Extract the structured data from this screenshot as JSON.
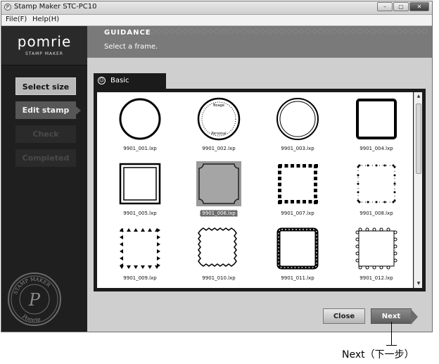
{
  "window": {
    "title": "Stamp Maker STC-PC10",
    "app_icon_glyph": "P",
    "controls": [
      "–",
      "▢",
      "✕"
    ]
  },
  "menu": [
    "File(F)",
    "Help(H)"
  ],
  "brand": {
    "logo": "pomrie",
    "tagline": "STAMP MAKER"
  },
  "steps": [
    {
      "label": "Select size",
      "state": "done"
    },
    {
      "label": "Edit stamp",
      "state": "current"
    },
    {
      "label": "Check",
      "state": "disabled"
    },
    {
      "label": "Completed",
      "state": "disabled"
    }
  ],
  "seal": {
    "top_text": "STAMP MAKER",
    "bottom_text": "Pomrie",
    "center": "P"
  },
  "guidance": {
    "title": "GUIDANCE",
    "message": "Select a frame."
  },
  "tab": {
    "label": "Basic",
    "icon": "smiley-icon"
  },
  "frames": [
    {
      "file": "9901_001.lxp",
      "shape": "circle-bold"
    },
    {
      "file": "9901_002.lxp",
      "shape": "circle-text"
    },
    {
      "file": "9901_003.lxp",
      "shape": "circle-double"
    },
    {
      "file": "9901_004.lxp",
      "shape": "square-bold"
    },
    {
      "file": "9901_005.lxp",
      "shape": "square-double"
    },
    {
      "file": "9901_006.lxp",
      "shape": "square-notched",
      "selected": true
    },
    {
      "file": "9901_007.lxp",
      "shape": "square-blocks"
    },
    {
      "file": "9901_008.lxp",
      "shape": "square-dots"
    },
    {
      "file": "9901_009.lxp",
      "shape": "square-triangles"
    },
    {
      "file": "9901_010.lxp",
      "shape": "square-zigzag"
    },
    {
      "file": "9901_011.lxp",
      "shape": "square-beads"
    },
    {
      "file": "9901_012.lxp",
      "shape": "square-scallop"
    }
  ],
  "buttons": {
    "close": "Close",
    "next": "Next"
  },
  "annotation": "Next（下一步）",
  "colors": {
    "sidebar": "#1f1f1f",
    "guidance": "#7a7a7a",
    "selected": "#9a9a9a"
  }
}
